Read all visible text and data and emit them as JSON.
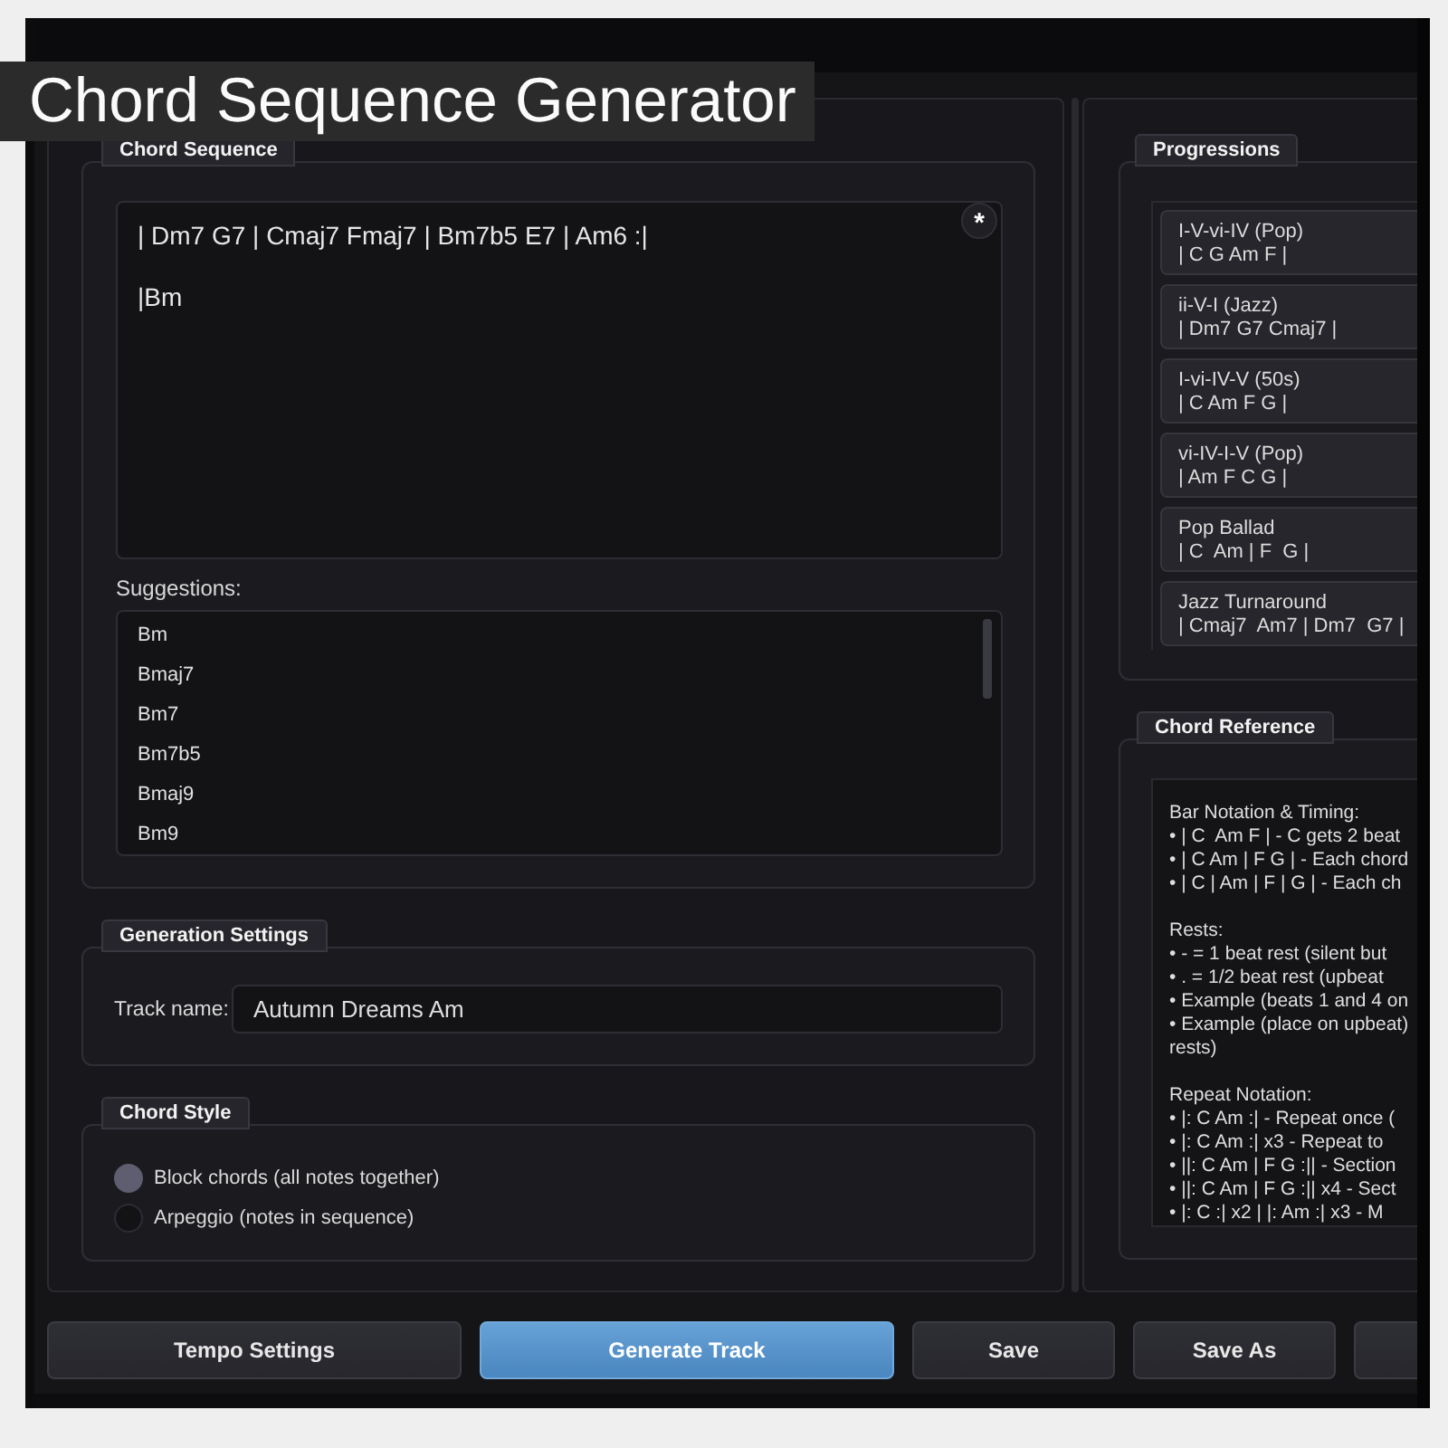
{
  "title_banner": "Chord Sequence Generator",
  "chord_sequence": {
    "title": "Chord Sequence",
    "value": "| Dm7 G7 | Cmaj7 Fmaj7 | Bm7b5 E7 | Am6 :|\n\n|Bm",
    "corner_button": "*",
    "suggestions_label": "Suggestions:",
    "suggestions": [
      "Bm",
      "Bmaj7",
      "Bm7",
      "Bm7b5",
      "Bmaj9",
      "Bm9"
    ]
  },
  "generation_settings": {
    "title": "Generation Settings",
    "track_name_label": "Track name:",
    "track_name": "Autumn Dreams Am"
  },
  "chord_style": {
    "title": "Chord Style",
    "options": [
      {
        "label": "Block chords (all notes together)",
        "selected": true
      },
      {
        "label": "Arpeggio (notes in sequence)",
        "selected": false
      }
    ]
  },
  "progressions": {
    "title": "Progressions",
    "items": [
      {
        "name": "I-V-vi-IV (Pop)",
        "chords": "| C G Am F |"
      },
      {
        "name": "ii-V-I (Jazz)",
        "chords": "| Dm7 G7 Cmaj7 |"
      },
      {
        "name": "I-vi-IV-V (50s)",
        "chords": "| C Am F G |"
      },
      {
        "name": "vi-IV-I-V (Pop)",
        "chords": "| Am F C G |"
      },
      {
        "name": "Pop Ballad",
        "chords": "| C  Am | F  G |"
      },
      {
        "name": "Jazz Turnaround",
        "chords": "| Cmaj7  Am7 | Dm7  G7 |"
      }
    ]
  },
  "chord_reference": {
    "title": "Chord Reference",
    "sections": [
      {
        "heading": "Bar Notation & Timing:",
        "lines": [
          "• | C  Am F | - C gets 2 beat",
          "• | C Am | F G | - Each chord",
          "• | C | Am | F | G | - Each ch"
        ]
      },
      {
        "heading": "Rests:",
        "lines": [
          "• - = 1 beat rest (silent but",
          "• . = 1/2 beat rest (upbeat",
          "• Example (beats 1 and 4 on",
          "• Example (place on upbeat)",
          "rests)"
        ]
      },
      {
        "heading": "Repeat Notation:",
        "lines": [
          "• |: C Am :| - Repeat once (",
          "• |: C Am :| x3 - Repeat to",
          "• ||: C Am | F G :|| - Section",
          "• ||: C Am | F G :|| x4 - Sect",
          "• |: C :| x2 | |: Am :| x3 - M"
        ]
      }
    ]
  },
  "buttons": [
    {
      "label": "Tempo Settings",
      "kind": "normal"
    },
    {
      "label": "Generate Track",
      "kind": "primary"
    },
    {
      "label": "Save",
      "kind": "normal"
    },
    {
      "label": "Save As",
      "kind": "normal"
    },
    {
      "kind": "normal"
    }
  ]
}
